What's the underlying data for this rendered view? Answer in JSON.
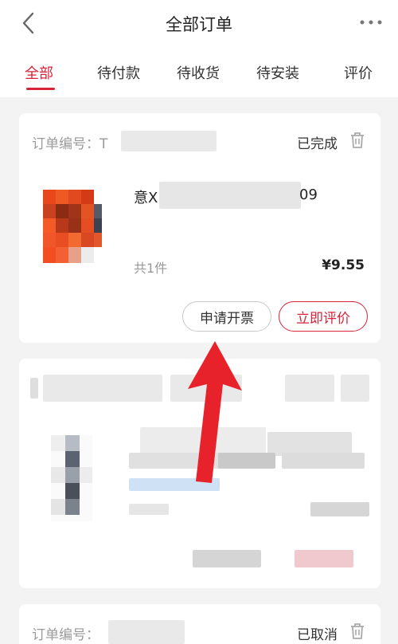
{
  "header": {
    "title": "全部订单",
    "back_icon": "chevron-left-icon",
    "more_icon": "more-dots-icon"
  },
  "tabs": [
    {
      "label": "全部",
      "active": true
    },
    {
      "label": "待付款",
      "active": false
    },
    {
      "label": "待收货",
      "active": false
    },
    {
      "label": "待安装",
      "active": false
    },
    {
      "label": "评价",
      "active": false
    }
  ],
  "orders": [
    {
      "order_label": "订单编号：T",
      "status": "已完成",
      "product_title": "意Ⅹ",
      "product_title_tail": "09",
      "quantity": "共1件",
      "price": "¥9.55",
      "actions": [
        "申请开票",
        "立即评价"
      ]
    },
    {
      "order_label": "订单编号：",
      "status": "已取消"
    }
  ],
  "colors": {
    "accent": "#d6243a",
    "arrow": "#e8222a"
  }
}
